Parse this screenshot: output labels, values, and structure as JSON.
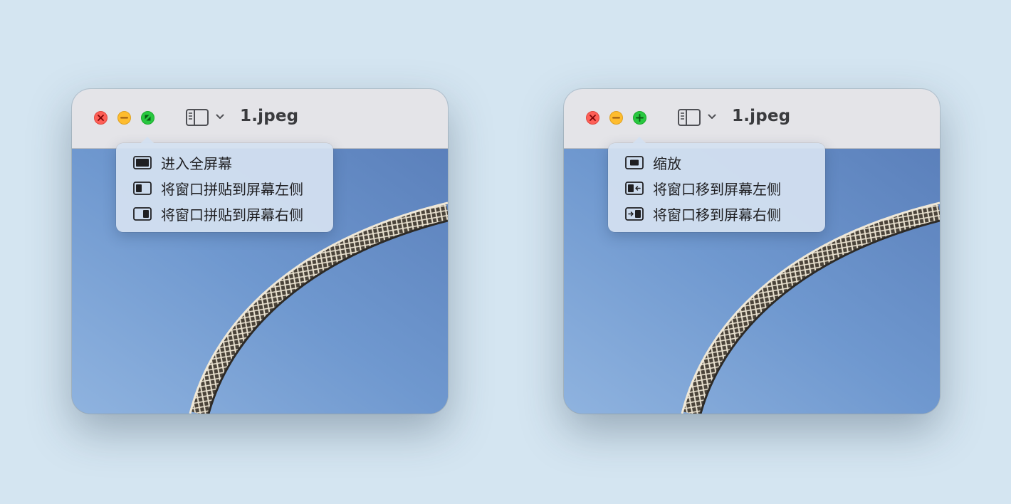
{
  "left_window": {
    "title": "1.jpeg",
    "traffic_lights": {
      "close": "close-icon",
      "minimize": "minimize-icon",
      "zoom": "fullscreen-icon"
    },
    "menu": [
      {
        "label": "进入全屏幕",
        "icon": "fullscreen-icon"
      },
      {
        "label": "将窗口拼贴到屏幕左侧",
        "icon": "tile-left-icon"
      },
      {
        "label": "将窗口拼贴到屏幕右侧",
        "icon": "tile-right-icon"
      }
    ]
  },
  "right_window": {
    "title": "1.jpeg",
    "traffic_lights": {
      "close": "close-icon",
      "minimize": "minimize-icon",
      "zoom": "zoom-plus-icon"
    },
    "menu": [
      {
        "label": "缩放",
        "icon": "zoom-icon"
      },
      {
        "label": "将窗口移到屏幕左侧",
        "icon": "move-left-icon"
      },
      {
        "label": "将窗口移到屏幕右侧",
        "icon": "move-right-icon"
      }
    ]
  },
  "colors": {
    "background": "#d4e5f1",
    "titlebar": "#e4e4e8",
    "close": "#fe5f57",
    "minimize": "#febc2e",
    "zoom": "#28c840",
    "sky": "#6a93c9",
    "menu": "#d3e0f0"
  }
}
